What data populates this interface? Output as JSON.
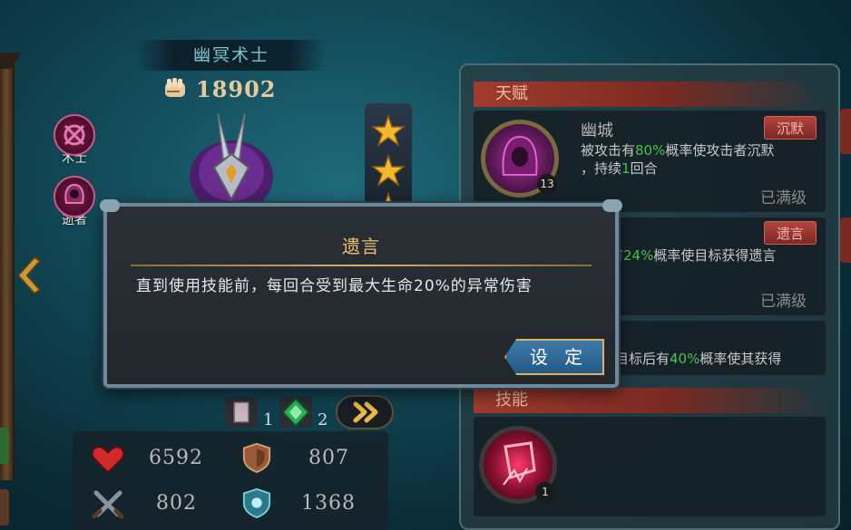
{
  "hero": {
    "name": "幽冥术士",
    "power": "18902",
    "classes": [
      {
        "label": "术士",
        "icon": "warlock-class-icon"
      },
      {
        "label": "逝者",
        "icon": "undead-class-icon"
      }
    ],
    "stars": 3
  },
  "items": [
    {
      "icon": "scroll-icon",
      "count": "1"
    },
    {
      "icon": "green-gem-icon",
      "count": "2"
    }
  ],
  "stats": {
    "hp": "6592",
    "defense": "807",
    "attack": "802",
    "magic_defense": "1368"
  },
  "panel": {
    "talent_header": "天赋",
    "skill_header": "技能",
    "talents": [
      {
        "name": "幽城",
        "desc_pre": "被攻击有",
        "desc_pct": "80%",
        "desc_mid": "概率使攻击者沉默",
        "desc_line2_pre": "，持续",
        "desc_num": "1",
        "desc_line2_post": "回合",
        "tag": "沉默",
        "status": "已满级",
        "level": "13"
      },
      {
        "desc_pre": "有",
        "desc_pct": "24%",
        "desc_post": "概率使目标获得遗言",
        "tag": "遗言",
        "status": "已满级"
      },
      {
        "desc_pre": "目标后有",
        "desc_pct": "40%",
        "desc_post": "概率使其获得"
      }
    ],
    "skill": {
      "level": "1"
    }
  },
  "modal": {
    "title": "遗言",
    "body": "直到使用技能前，每回合受到最大生命20%的异常伤害",
    "confirm": "设 定"
  },
  "colors": {
    "accent_gold": "#f0c070",
    "tag_red": "#b2453e",
    "highlight_green": "#4cc24c",
    "button_blue": "#3f7aa6"
  }
}
